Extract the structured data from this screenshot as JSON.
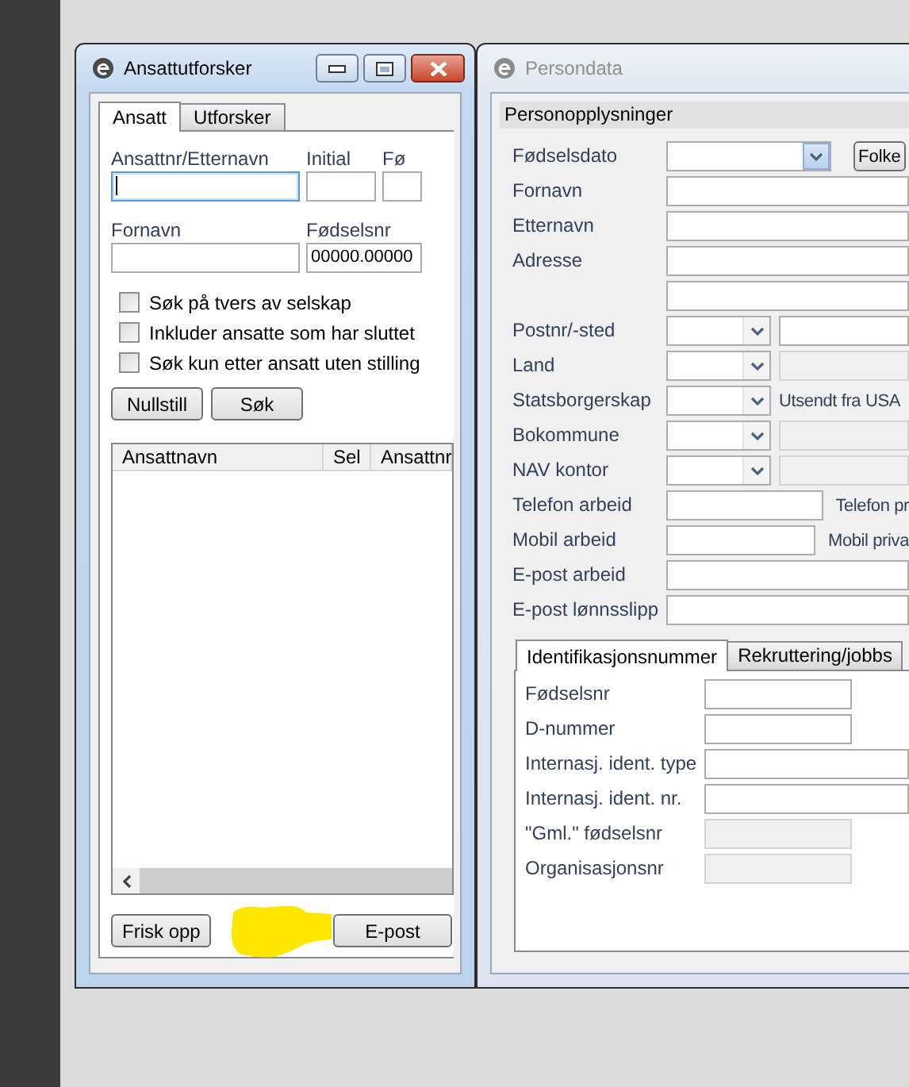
{
  "employee_search": {
    "title": "Ansattutforsker",
    "active": true,
    "window_buttons": [
      {
        "kind": "minimize"
      },
      {
        "kind": "maximize"
      },
      {
        "kind": "close"
      }
    ],
    "tabs": [
      {
        "label": "Ansatt",
        "selected": true
      },
      {
        "label": "Utforsker",
        "selected": false
      }
    ],
    "fields": [
      {
        "label": "Ansattnr/Etternavn",
        "focused": true
      },
      {
        "label": "Initial",
        "focused": false
      },
      {
        "label": "Fø",
        "focused": false
      },
      {
        "label": "Fornavn",
        "focused": false
      },
      {
        "label": "Fødselsnr",
        "value": "00000.00000",
        "focused": false
      }
    ],
    "checkboxes": [
      {
        "label": "Søk på tvers av selskap",
        "checked": false
      },
      {
        "label": "Inkluder ansatte som har sluttet",
        "checked": false
      },
      {
        "label": "Søk kun etter ansatt uten stilling",
        "checked": false
      }
    ],
    "search_buttons": [
      "Nullstill",
      "Søk"
    ],
    "grid": {
      "columns": [
        "Ansattnavn",
        "Sel",
        "Ansattnr"
      ]
    },
    "footer_buttons": [
      "Frisk opp",
      "E-post"
    ]
  },
  "person_data": {
    "title": "Persondata",
    "active": false,
    "group": "Personopplysninger",
    "rows": [
      {
        "kind": "date",
        "label": "Fødselsdato",
        "button": "Folke"
      },
      {
        "kind": "text",
        "label": "Fornavn"
      },
      {
        "kind": "text",
        "label": "Etternavn"
      },
      {
        "kind": "text",
        "label": "Adresse"
      },
      {
        "kind": "text"
      },
      {
        "kind": "combo",
        "label": "Postnr/-sted",
        "next": {
          "kind": "field",
          "disabled": false
        }
      },
      {
        "kind": "combo",
        "label": "Land",
        "next": {
          "kind": "field",
          "disabled": true
        }
      },
      {
        "kind": "combo",
        "label": "Statsborgerskap",
        "next": {
          "kind": "label",
          "text": "Utsendt fra USA"
        }
      },
      {
        "kind": "combo",
        "label": "Bokommune",
        "next": {
          "kind": "field",
          "disabled": true
        }
      },
      {
        "kind": "combo",
        "label": "NAV kontor",
        "next": {
          "kind": "field",
          "disabled": true
        }
      },
      {
        "kind": "short",
        "label": "Telefon arbeid",
        "next": {
          "kind": "label",
          "text": "Telefon pr"
        }
      },
      {
        "kind": "short",
        "label": "Mobil arbeid",
        "next": {
          "kind": "label",
          "text": "Mobil priva"
        }
      },
      {
        "kind": "text",
        "label": "E-post arbeid"
      },
      {
        "kind": "text",
        "label": "E-post lønnsslipp"
      }
    ],
    "tabs": [
      {
        "label": "Identifikasjonsnummer",
        "selected": true
      },
      {
        "label": "Rekruttering/jobbs",
        "selected": false
      }
    ],
    "id_fields": [
      {
        "kind": "short",
        "label": "Fødselsnr",
        "disabled": false
      },
      {
        "kind": "short",
        "label": "D-nummer",
        "disabled": false
      },
      {
        "kind": "wide",
        "label": "Internasj. ident. type",
        "disabled": false
      },
      {
        "kind": "wide",
        "label": "Internasj. ident. nr.",
        "disabled": false
      },
      {
        "kind": "short",
        "label": "\"Gml.\" fødselsnr",
        "disabled": true
      },
      {
        "kind": "short",
        "label": "Organisasjonsnr",
        "disabled": true
      }
    ]
  }
}
